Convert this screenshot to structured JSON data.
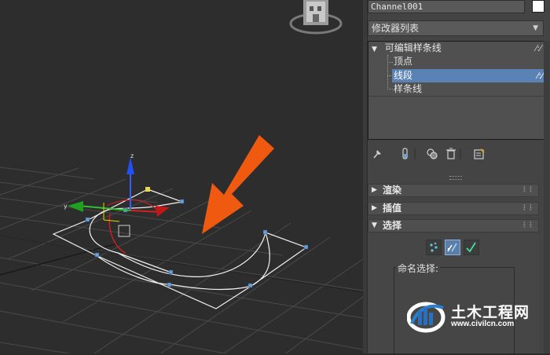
{
  "object": {
    "name": "Channel001",
    "color": "#ffffff"
  },
  "modifier_list": {
    "label": "修改器列表"
  },
  "stack": {
    "items": [
      {
        "label": "可编辑样条线",
        "level": 0,
        "expanded": true
      },
      {
        "label": "顶点",
        "level": 1
      },
      {
        "label": "线段",
        "level": 1,
        "selected": true
      },
      {
        "label": "样条线",
        "level": 1
      }
    ]
  },
  "toolbar_icons": [
    "pin-stack-icon",
    "show-end-result-icon",
    "make-unique-icon",
    "remove-modifier-icon",
    "configure-modifier-sets-icon"
  ],
  "rollouts": [
    {
      "label": "渲染",
      "expanded": false
    },
    {
      "label": "插值",
      "expanded": false
    },
    {
      "label": "选择",
      "expanded": true
    }
  ],
  "selection": {
    "levels": [
      "vertex-icon",
      "segment-icon",
      "spline-icon"
    ],
    "active": "segment-icon",
    "named_selection_label": "命名选择:"
  },
  "watermark": {
    "title": "土木工程网",
    "url": "www.civilcn.com"
  },
  "colors": {
    "selection_highlight": "#5b82b5",
    "annotation_arrow": "#f05a10",
    "vertex_handle": "#6a9fd8",
    "first_vertex": "#e8d84a"
  }
}
